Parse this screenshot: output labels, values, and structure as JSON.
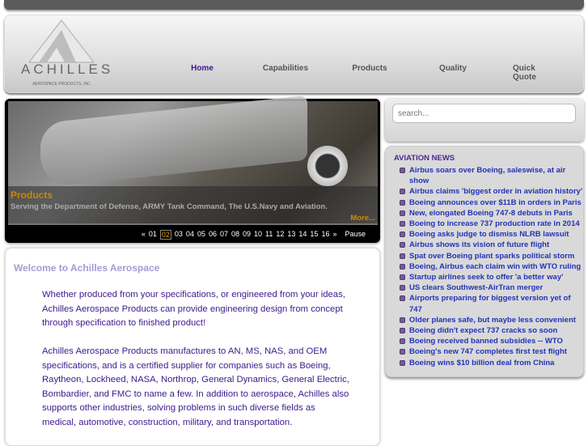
{
  "logo": {
    "name": "ACHILLES",
    "subtitle": "AEROSPACE PRODUCTS, INC"
  },
  "nav": [
    {
      "label": "Home",
      "active": true
    },
    {
      "label": "Capabilities"
    },
    {
      "label": "Products"
    },
    {
      "label": "Quality"
    },
    {
      "label": "Quick Quote"
    }
  ],
  "slideshow": {
    "title": "Products",
    "text": "Serving the Department of Defense, ARMY Tank Command, The U.S.Navy and Aviation.",
    "more": "More...",
    "prev": "«",
    "next": "»",
    "pages": [
      "01",
      "02",
      "03",
      "04",
      "05",
      "06",
      "07",
      "08",
      "09",
      "10",
      "11",
      "12",
      "13",
      "14",
      "15",
      "16"
    ],
    "current": "02",
    "pause": "Pause"
  },
  "search": {
    "placeholder": "search..."
  },
  "news": {
    "title": "AVIATION NEWS",
    "items": [
      "Airbus soars over Boeing, saleswise, at air show",
      "Airbus claims 'biggest order in aviation history'",
      "Boeing announces over $11B in orders in Paris",
      "New, elongated Boeing 747-8 debuts in Paris",
      "Boeing to increase 737 production rate in 2014",
      "Boeing asks judge to dismiss NLRB lawsuit",
      "Airbus shows its vision of future flight",
      "Spat over Boeing plant sparks political storm",
      "Boeing, Airbus each claim win with WTO ruling",
      "Startup airlines seek to offer 'a better way'",
      "US clears Southwest-AirTran merger",
      "Airports preparing for biggest version yet of 747",
      "Older planes safe, but maybe less convenient",
      "Boeing didn't expect 737 cracks so soon",
      "Boeing received banned subsidies -- WTO",
      "Boeing's new 747 completes first test flight",
      "Boeing wins $10 billion deal from China"
    ]
  },
  "welcome": {
    "title": "Welcome to Achilles Aerospace",
    "paragraphs": [
      "Whether produced from your specifications, or engineered from your ideas, Achilles Aerospace Products can provide engineering design from concept through specification to finished product!",
      "Achilles Aerospace Products manufactures to AN, MS, NAS, and OEM specifications, and is a certified supplier for companies such as Boeing, Raytheon, Lockheed, NASA, Northrop, General Dynamics, General Electric, Bombardier, and FMC to name a few.  In addition to aerospace, Achilles also supports other industries, solving problems in such diverse fields as medical, automotive, construction, military, and transportation."
    ]
  },
  "colors": {
    "nav_active": "#3b1a8c",
    "news_link": "#2332b8",
    "slide_accent": "#c98a00"
  }
}
